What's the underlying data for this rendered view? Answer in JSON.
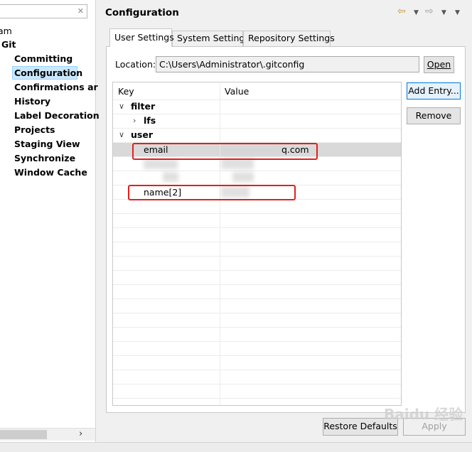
{
  "left_panel": {
    "items": [
      {
        "label": "am",
        "bold": false
      },
      {
        "label": "Git",
        "bold": true
      },
      {
        "label": "Committing",
        "bold": true
      },
      {
        "label": "Configuration",
        "bold": true
      },
      {
        "label": "Confirmations ar",
        "bold": true
      },
      {
        "label": "History",
        "bold": true
      },
      {
        "label": "Label Decoration",
        "bold": true
      },
      {
        "label": "Projects",
        "bold": true
      },
      {
        "label": "Staging View",
        "bold": true
      },
      {
        "label": "Synchronize",
        "bold": true
      },
      {
        "label": "Window Cache",
        "bold": true
      }
    ],
    "selected": "Configuration"
  },
  "header": {
    "title": "Configuration",
    "back_icon": "back-arrow-icon",
    "forward_icon": "forward-arrow-icon"
  },
  "tabs": [
    {
      "label": "User Settings",
      "active": true
    },
    {
      "label": "System Settings",
      "active": false
    },
    {
      "label": "Repository Settings",
      "active": false
    }
  ],
  "location": {
    "label": "Location:",
    "value": "C:\\Users\\Administrator\\.gitconfig",
    "open_label": "Open"
  },
  "table": {
    "columns": [
      "Key",
      "Value"
    ],
    "rows": [
      {
        "key": "filter",
        "value": "",
        "level": 0,
        "expanded": true,
        "bold": true
      },
      {
        "key": "lfs",
        "value": "",
        "level": 1,
        "expanded": false,
        "bold": true
      },
      {
        "key": "user",
        "value": "",
        "level": 0,
        "expanded": true,
        "bold": true
      },
      {
        "key": "email",
        "value": "q.com",
        "level": 2,
        "selected": true
      },
      {
        "key": "name[2]",
        "value": "",
        "level": 2
      }
    ]
  },
  "side_buttons": {
    "add_label": "Add Entry...",
    "remove_label": "Remove"
  },
  "footer": {
    "restore_label": "Restore Defaults",
    "apply_label": "Apply"
  },
  "watermark": "Baidu 经验",
  "colors": {
    "selection": "#cce8ff",
    "annotation_red": "#e02020",
    "nav_arrow": "#c89a2a"
  }
}
